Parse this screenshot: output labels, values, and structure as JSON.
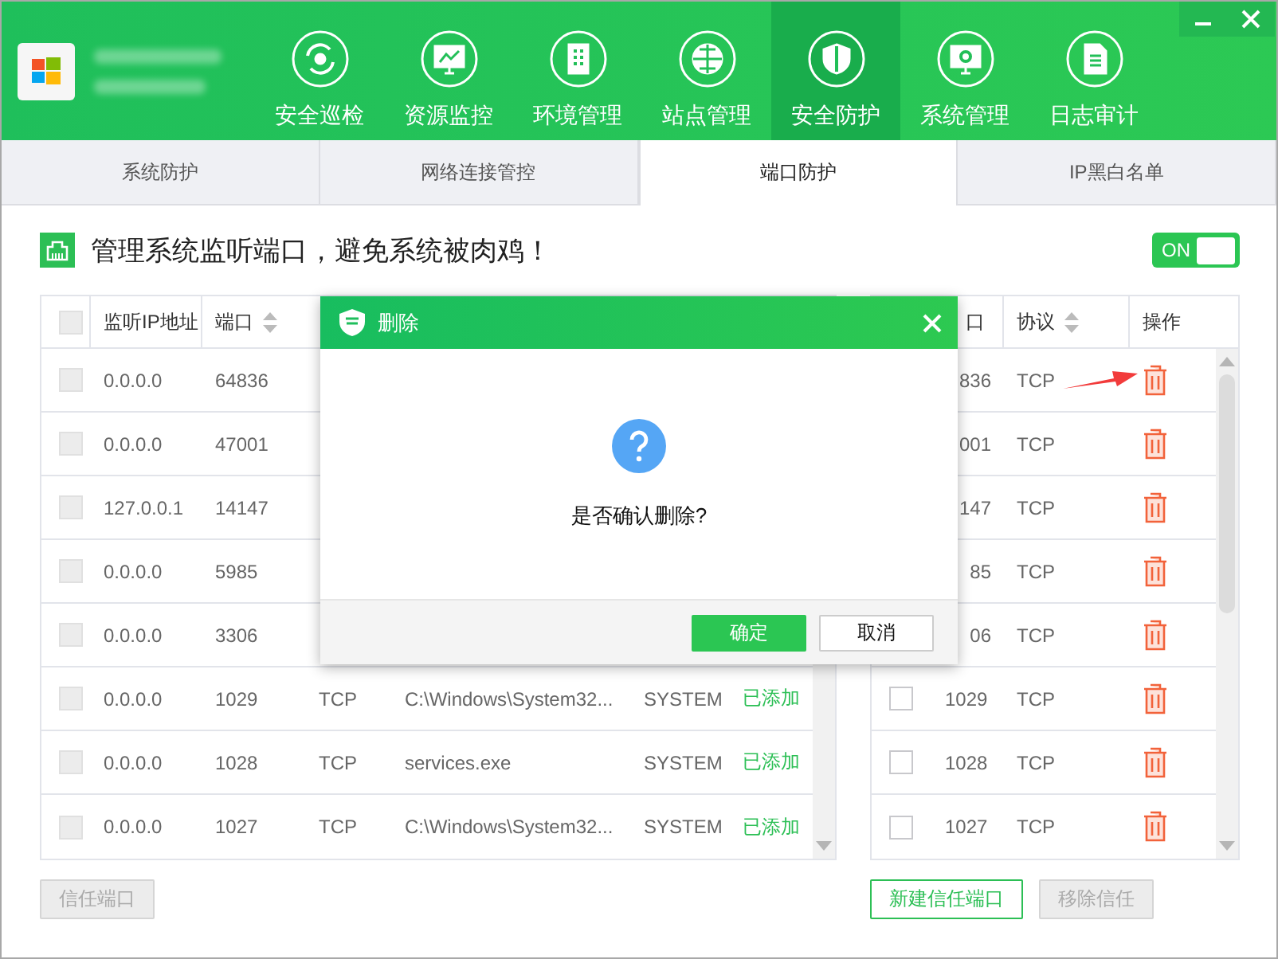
{
  "nav": [
    {
      "label": "安全巡检",
      "kind": "patrol",
      "selected": false
    },
    {
      "label": "资源监控",
      "kind": "monitor",
      "selected": false
    },
    {
      "label": "环境管理",
      "kind": "building",
      "selected": false
    },
    {
      "label": "站点管理",
      "kind": "globe",
      "selected": false
    },
    {
      "label": "安全防护",
      "kind": "shield",
      "selected": true
    },
    {
      "label": "系统管理",
      "kind": "settings",
      "selected": false
    },
    {
      "label": "日志审计",
      "kind": "document",
      "selected": false
    }
  ],
  "subtabs": [
    {
      "label": "系统防护",
      "selected": false
    },
    {
      "label": "网络连接管控",
      "selected": false
    },
    {
      "label": "端口防护",
      "selected": true
    },
    {
      "label": "IP黑白名单",
      "selected": false
    }
  ],
  "banner": {
    "text": "管理系统监听端口，避免系统被肉鸡！",
    "toggle": {
      "label": "ON",
      "on": true
    }
  },
  "left_table": {
    "checkbox_disabled": true,
    "header_checked": false,
    "columns": [
      {
        "label": "监听IP地址",
        "sortable": false
      },
      {
        "label": "端口",
        "sortable": true
      }
    ],
    "rows": [
      {
        "ip": "0.0.0.0",
        "port": "64836",
        "checked": false
      },
      {
        "ip": "0.0.0.0",
        "port": "47001",
        "checked": false
      },
      {
        "ip": "127.0.0.1",
        "port": "14147",
        "checked": false
      },
      {
        "ip": "0.0.0.0",
        "port": "5985",
        "checked": false
      },
      {
        "ip": "0.0.0.0",
        "port": "3306",
        "checked": false
      },
      {
        "ip": "0.0.0.0",
        "port": "1029",
        "protocol": "TCP",
        "path": "C:\\Windows\\System32...",
        "user": "SYSTEM",
        "status": "已添加",
        "checked": false
      },
      {
        "ip": "0.0.0.0",
        "port": "1028",
        "protocol": "TCP",
        "path": "services.exe",
        "user": "SYSTEM",
        "status": "已添加",
        "checked": false
      },
      {
        "ip": "0.0.0.0",
        "port": "1027",
        "protocol": "TCP",
        "path": "C:\\Windows\\System32...",
        "user": "SYSTEM",
        "status": "已添加",
        "checked": false
      }
    ]
  },
  "right_table": {
    "checkbox_disabled": false,
    "columns": [
      {
        "label": "口",
        "sortable": false
      },
      {
        "label": "协议",
        "sortable": true
      },
      {
        "label": "操作",
        "sortable": false
      }
    ],
    "rows": [
      {
        "port": "836",
        "protocol": "TCP"
      },
      {
        "port": "001",
        "protocol": "TCP"
      },
      {
        "port": "147",
        "protocol": "TCP"
      },
      {
        "port": "85",
        "protocol": "TCP"
      },
      {
        "port": "06",
        "protocol": "TCP"
      },
      {
        "port": "1029",
        "protocol": "TCP",
        "checked": false
      },
      {
        "port": "1028",
        "protocol": "TCP",
        "checked": false
      },
      {
        "port": "1027",
        "protocol": "TCP",
        "checked": false
      }
    ]
  },
  "left_buttons": [
    {
      "label": "信任端口",
      "disabled": true
    }
  ],
  "right_buttons": [
    {
      "label": "新建信任端口",
      "disabled": false
    },
    {
      "label": "移除信任",
      "disabled": true
    }
  ],
  "dialog": {
    "title": "删除",
    "message": "是否确认删除?",
    "buttons": [
      {
        "label": "确定",
        "kind": "primary"
      },
      {
        "label": "取消",
        "kind": "secondary"
      }
    ]
  }
}
